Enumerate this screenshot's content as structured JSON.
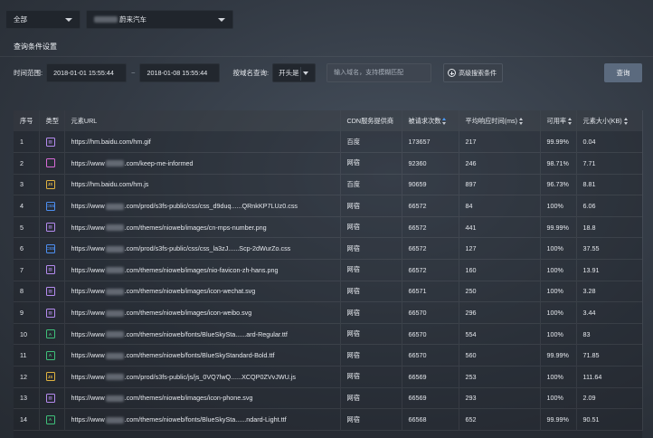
{
  "top": {
    "scope_select": "全部",
    "site_select_suffix": "蔚来汽车"
  },
  "section_title": "查询条件设置",
  "filters": {
    "time_label": "时间范围:",
    "start_time": "2018-01-01 15:55:44",
    "separator": "~",
    "end_time": "2018-01-08 15:55:44",
    "domain_label": "按域名查询:",
    "match_mode": "开头是",
    "domain_placeholder": "输入域名，支持模糊匹配",
    "advanced_button": "高级搜索条件",
    "query_button": "查询"
  },
  "table": {
    "headers": {
      "index": "序号",
      "type": "类型",
      "url": "元素URL",
      "cdn": "CDN服务提供商",
      "requests": "被请求次数",
      "resp_time": "平均响应时间(ms)",
      "availability": "可用率",
      "size": "元素大小(KB)"
    },
    "rows": [
      {
        "index": "1",
        "type": "img-icon",
        "url": "https://hm.baidu.com/hm.gif",
        "cdn": "百度",
        "requests": "173657",
        "resp_time": "217",
        "availability": "99.99%",
        "size": "0.04"
      },
      {
        "index": "2",
        "type": "html-icon",
        "url_pre": "https://www",
        "url_post": ".com/keep-me-informed",
        "cdn": "网宿",
        "requests": "92360",
        "resp_time": "246",
        "availability": "98.71%",
        "size": "7.71"
      },
      {
        "index": "3",
        "type": "js-icon",
        "url": "https://hm.baidu.com/hm.js",
        "cdn": "百度",
        "requests": "90659",
        "resp_time": "897",
        "availability": "96.73%",
        "size": "8.81"
      },
      {
        "index": "4",
        "type": "css-icon",
        "url_pre": "https://www",
        "url_post": ".com/prod/s3fs-public/css/css_d9duq......QRnkKP7LUz0.css",
        "cdn": "网宿",
        "requests": "66572",
        "resp_time": "84",
        "availability": "100%",
        "size": "6.06"
      },
      {
        "index": "5",
        "type": "img-icon",
        "url_pre": "https://www",
        "url_post": ".com/themes/nioweb/images/cn-mps-number.png",
        "cdn": "网宿",
        "requests": "66572",
        "resp_time": "441",
        "availability": "99.99%",
        "size": "18.8"
      },
      {
        "index": "6",
        "type": "css-icon",
        "url_pre": "https://www",
        "url_post": ".com/prod/s3fs-public/css/css_la3zJ......Scp-2dWurZo.css",
        "cdn": "网宿",
        "requests": "66572",
        "resp_time": "127",
        "availability": "100%",
        "size": "37.55"
      },
      {
        "index": "7",
        "type": "img-icon",
        "url_pre": "https://www",
        "url_post": ".com/themes/nioweb/images/nio-favicon-zh-hans.png",
        "cdn": "网宿",
        "requests": "66572",
        "resp_time": "160",
        "availability": "100%",
        "size": "13.91"
      },
      {
        "index": "8",
        "type": "img-icon",
        "url_pre": "https://www",
        "url_post": ".com/themes/nioweb/images/icon-wechat.svg",
        "cdn": "网宿",
        "requests": "66571",
        "resp_time": "250",
        "availability": "100%",
        "size": "3.28"
      },
      {
        "index": "9",
        "type": "img-icon",
        "url_pre": "https://www",
        "url_post": ".com/themes/nioweb/images/icon-weibo.svg",
        "cdn": "网宿",
        "requests": "66570",
        "resp_time": "296",
        "availability": "100%",
        "size": "3.44"
      },
      {
        "index": "10",
        "type": "font-icon",
        "url_pre": "https://www",
        "url_post": ".com/themes/nioweb/fonts/BlueSkySta......ard-Regular.ttf",
        "cdn": "网宿",
        "requests": "66570",
        "resp_time": "554",
        "availability": "100%",
        "size": "83"
      },
      {
        "index": "11",
        "type": "font-icon",
        "url_pre": "https://www",
        "url_post": ".com/themes/nioweb/fonts/BlueSkyStandard-Bold.ttf",
        "cdn": "网宿",
        "requests": "66570",
        "resp_time": "560",
        "availability": "99.99%",
        "size": "71.85"
      },
      {
        "index": "12",
        "type": "js-icon",
        "url_pre": "https://www",
        "url_post": ".com/prod/s3fs-public/js/js_0VQ7lwQ......XCQP0ZVvJWU.js",
        "cdn": "网宿",
        "requests": "66569",
        "resp_time": "253",
        "availability": "100%",
        "size": "111.64"
      },
      {
        "index": "13",
        "type": "img-icon",
        "url_pre": "https://www",
        "url_post": ".com/themes/nioweb/images/icon-phone.svg",
        "cdn": "网宿",
        "requests": "66569",
        "resp_time": "293",
        "availability": "100%",
        "size": "2.09"
      },
      {
        "index": "14",
        "type": "font-icon",
        "url_pre": "https://www",
        "url_post": ".com/themes/nioweb/fonts/BlueSkySta......ndard-Light.ttf",
        "cdn": "网宿",
        "requests": "66568",
        "resp_time": "652",
        "availability": "99.99%",
        "size": "90.51"
      }
    ]
  }
}
